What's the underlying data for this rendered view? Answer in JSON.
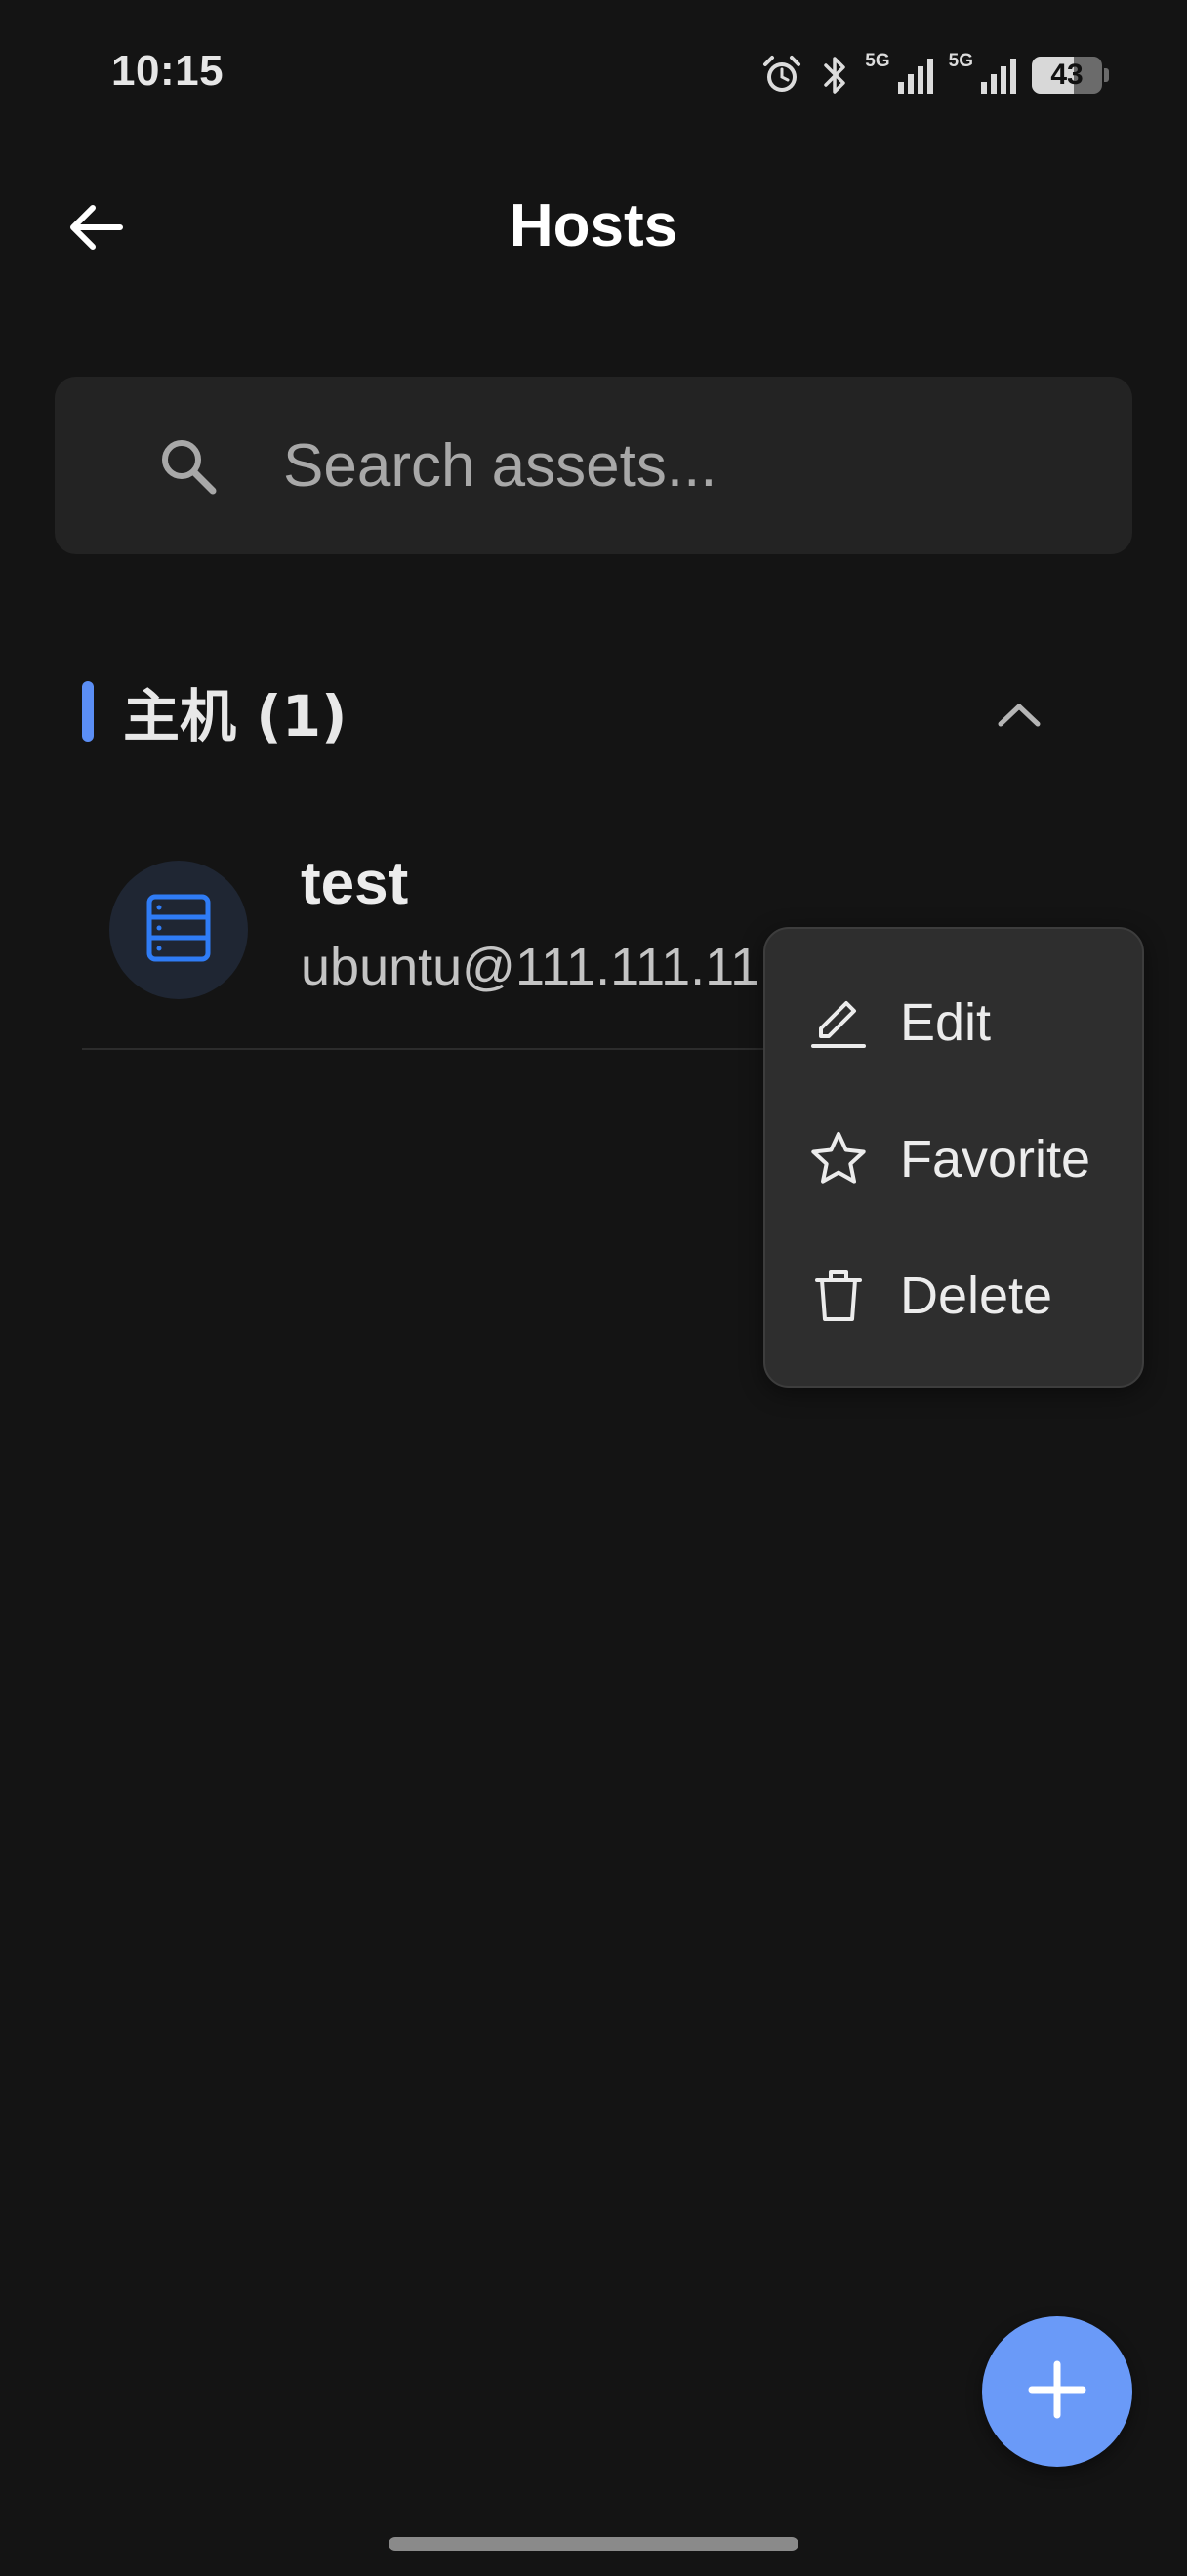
{
  "status_bar": {
    "time": "10:15",
    "network_1": "5G",
    "network_2": "5G",
    "battery": "43",
    "icons": [
      "alarm-icon",
      "bluetooth-icon",
      "signal-icon",
      "signal-icon",
      "battery-icon"
    ]
  },
  "app_bar": {
    "title": "Hosts",
    "back_icon": "arrow-left-icon"
  },
  "search": {
    "placeholder": "Search assets...",
    "value": "",
    "icon": "search-icon"
  },
  "section": {
    "title": "主机 (1)",
    "accent_color": "#5b8ef5",
    "expanded": true,
    "collapse_icon": "chevron-up-icon"
  },
  "hosts": [
    {
      "name": "test",
      "address": "ubuntu@111.111.11.1",
      "icon": "server-icon",
      "icon_color": "#2f7cf6"
    }
  ],
  "context_menu": {
    "items": [
      {
        "label": "Edit",
        "icon": "edit-icon"
      },
      {
        "label": "Favorite",
        "icon": "star-icon"
      },
      {
        "label": "Delete",
        "icon": "trash-icon"
      }
    ]
  },
  "fab": {
    "icon": "plus-icon",
    "color": "#6a9af8"
  },
  "colors": {
    "background": "#141414",
    "surface": "#232323",
    "menu_surface": "#2e2e2e"
  }
}
